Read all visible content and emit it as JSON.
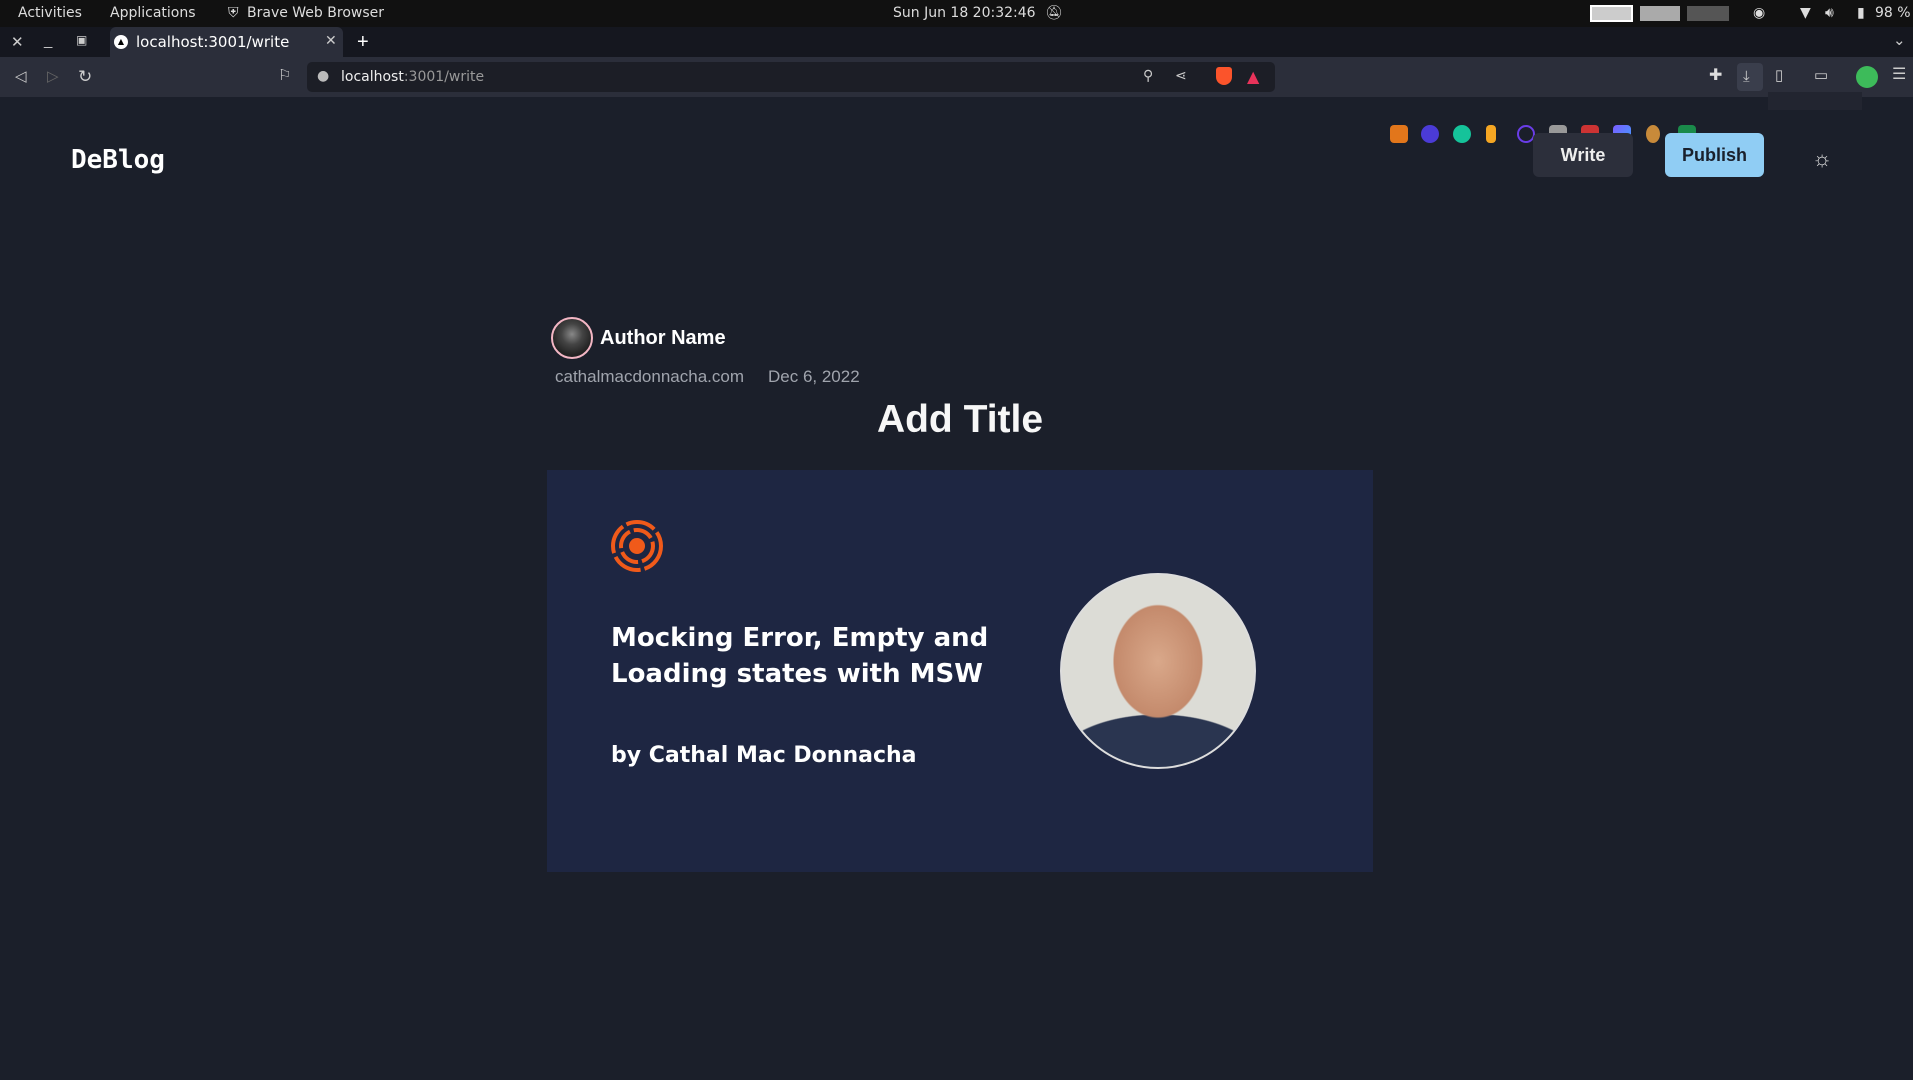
{
  "system_bar": {
    "activities": "Activities",
    "applications": "Applications",
    "app_name": "Brave Web Browser",
    "datetime": "Sun Jun 18  20:32:46",
    "battery": "98 %"
  },
  "browser": {
    "tab_title": "localhost:3001/write",
    "url_host": "localhost",
    "url_path": ":3001/write"
  },
  "header": {
    "logo": "DeBlog",
    "write_label": "Write",
    "publish_label": "Publish",
    "theme_icon": "sun-icon",
    "publish_color": "#90cdf4"
  },
  "post": {
    "author_name": "Author Name",
    "website": "cathalmacdonnacha.com",
    "date": "Dec 6, 2022",
    "title": "Add Title",
    "cover": {
      "headline_line1": "Mocking Error, Empty and",
      "headline_line2": "Loading states with MSW",
      "byline": "by Cathal Mac Donnacha",
      "accent": "#f05a1a"
    }
  }
}
